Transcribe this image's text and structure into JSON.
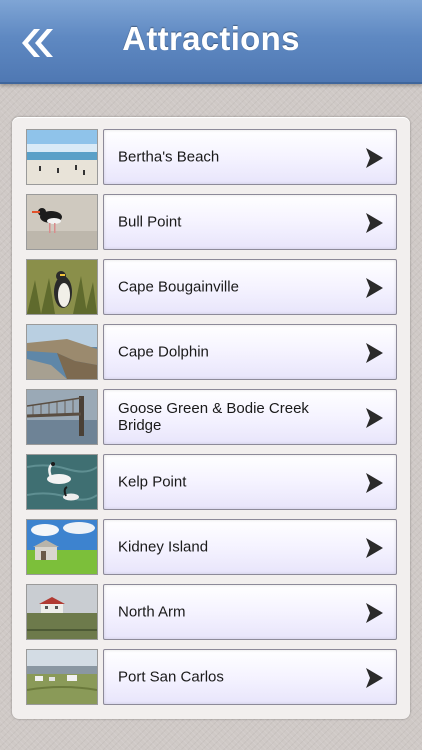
{
  "header": {
    "title": "Attractions",
    "back_icon": "double-chevron-left-icon"
  },
  "attractions": [
    {
      "label": "Bertha's Beach",
      "thumbnail": "beach-photo"
    },
    {
      "label": "Bull Point",
      "thumbnail": "oystercatcher-photo"
    },
    {
      "label": "Cape Bougainville",
      "thumbnail": "penguin-photo"
    },
    {
      "label": "Cape Dolphin",
      "thumbnail": "coast-photo"
    },
    {
      "label": "Goose Green & Bodie Creek Bridge",
      "thumbnail": "bridge-photo"
    },
    {
      "label": "Kelp Point",
      "thumbnail": "swans-photo"
    },
    {
      "label": "Kidney Island",
      "thumbnail": "shed-photo"
    },
    {
      "label": "North Arm",
      "thumbnail": "farmhouse-photo"
    },
    {
      "label": "Port San Carlos",
      "thumbnail": "settlement-photo"
    }
  ],
  "colors": {
    "nav_bar": "#5f89c2",
    "background": "#cfc9c6",
    "button_gradient_end": "#e8e5fb"
  }
}
